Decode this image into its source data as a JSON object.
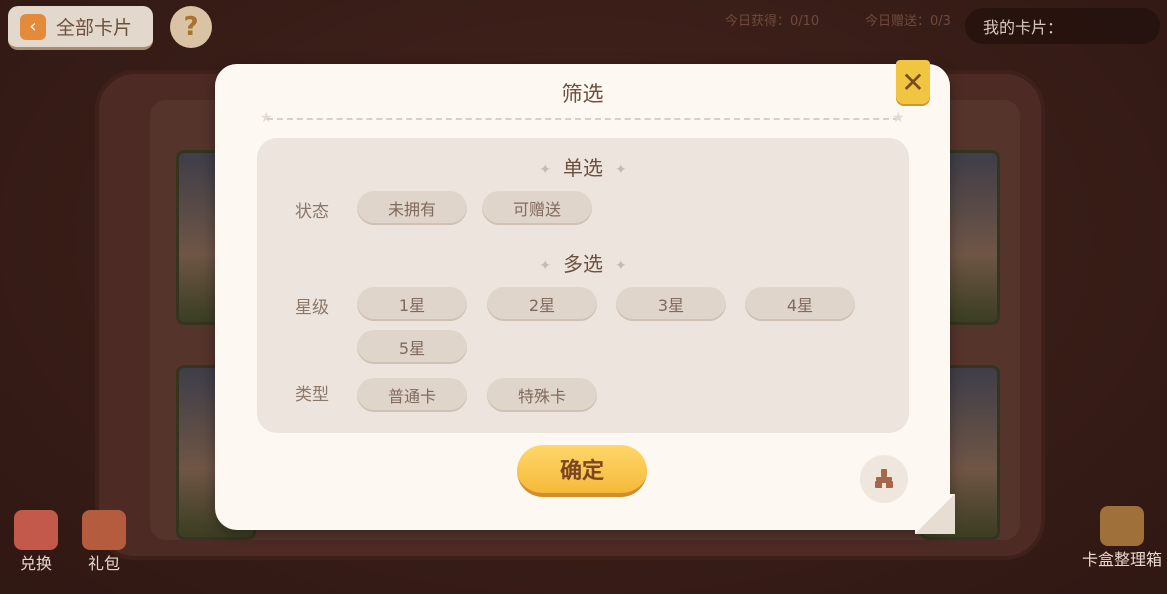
{
  "background": {
    "all_cards_label": "全部卡片",
    "help_label": "?",
    "today_obtain_label": "今日获得：0/10",
    "today_gift_label": "今日赠送：0/3",
    "my_cards_label": "我的卡片：",
    "exchange_label": "兑换",
    "gift_pack_label": "礼包",
    "card_box_label": "卡盒整理箱"
  },
  "dialog": {
    "title": "筛选",
    "close_icon": "close-icon",
    "single_select": {
      "title": "单选",
      "status_label": "状态",
      "options": [
        "未拥有",
        "可赠送"
      ]
    },
    "multi_select": {
      "title": "多选",
      "star_label": "星级",
      "star_options": [
        "1星",
        "2星",
        "3星",
        "4星",
        "5星"
      ],
      "type_label": "类型",
      "type_options": [
        "普通卡",
        "特殊卡"
      ]
    },
    "confirm_label": "确定",
    "reset_icon": "broom-icon"
  },
  "colors": {
    "accent": "#f5b93a",
    "dialog_bg": "#fdf8f1",
    "panel_bg": "#ece4dd",
    "chip_bg": "#e0d5cb",
    "text_brown": "#6d4f3d"
  }
}
